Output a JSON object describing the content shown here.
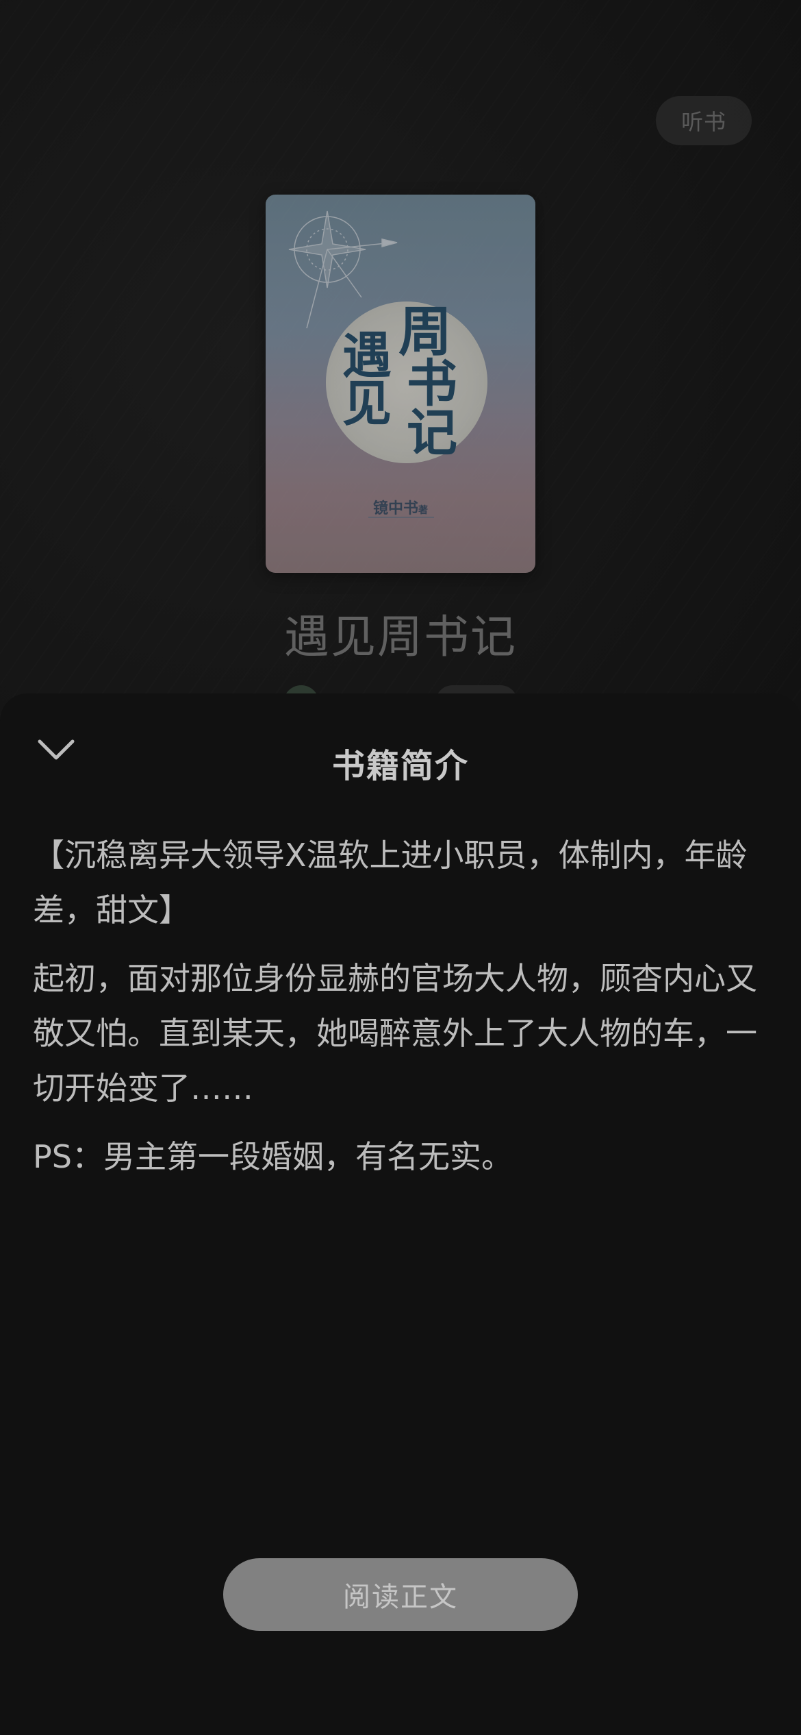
{
  "header": {
    "listen_label": "听书"
  },
  "book": {
    "title": "遇见周书记",
    "cover": {
      "title_chars": [
        "遇",
        "见",
        "周",
        "书",
        "记"
      ],
      "author_text": "镜中书",
      "author_suffix": "著"
    }
  },
  "sheet": {
    "title": "书籍简介",
    "paragraphs": [
      "【沉稳离异大领导X温软上进小职员，体制内，年龄差，甜文】",
      "起初，面对那位身份显赫的官场大人物，顾杳内心又敬又怕。直到某天，她喝醉意外上了大人物的车，一切开始变了……",
      "PS：男主第一段婚姻，有名无实。"
    ],
    "read_button_label": "阅读正文"
  },
  "icons": {
    "collapse": "chevron-down-icon"
  },
  "colors": {
    "background": "#0f0f0f",
    "sheet": "#111111",
    "read_button": "#818181",
    "cover_title": "#234a66"
  }
}
